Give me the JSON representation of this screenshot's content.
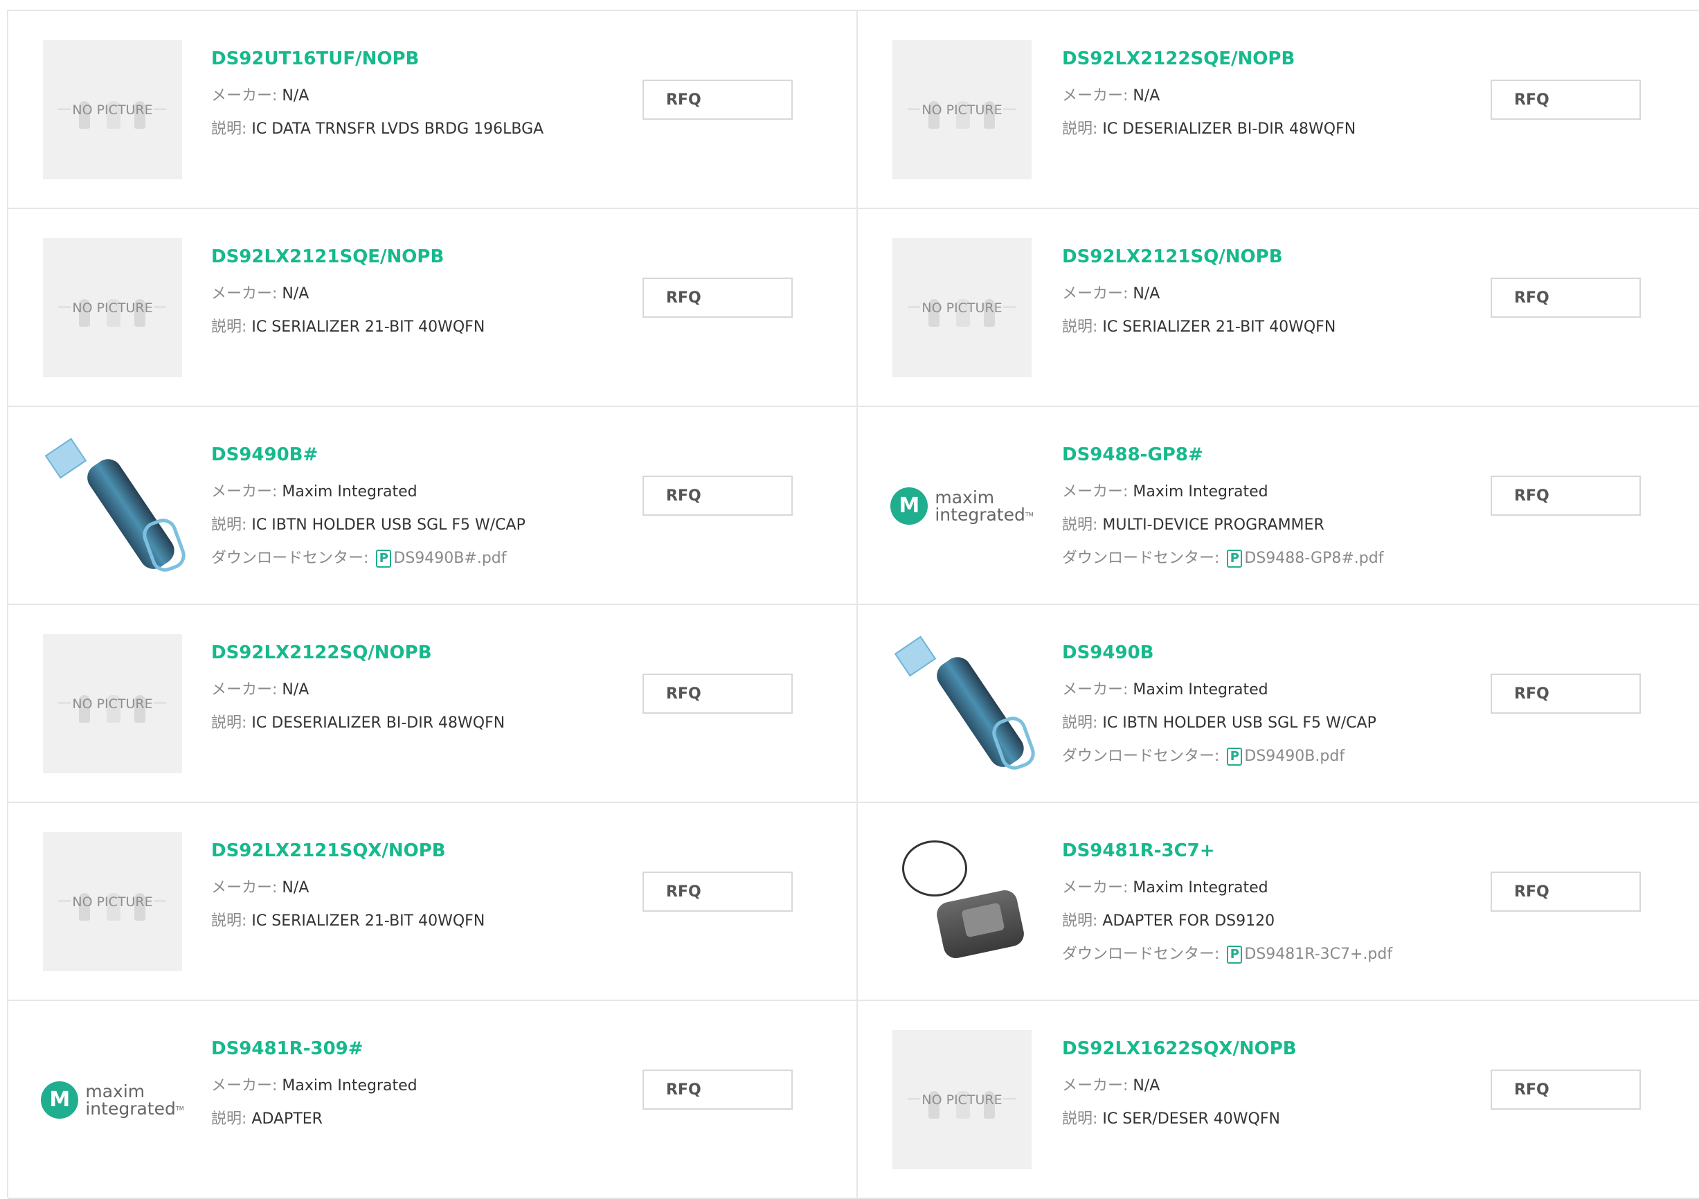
{
  "labels": {
    "maker": "メーカー: ",
    "desc": "説明: ",
    "download": "ダウンロードセンター: ",
    "rfq": "RFQ",
    "no_picture": "NO PICTURE",
    "maxim_line1": "maxim",
    "maxim_line2": "integrated",
    "maxim_tm": "TM"
  },
  "colors": {
    "accent": "#16b98c",
    "border": "#e6e6e6"
  },
  "products": [
    {
      "part": "DS92UT16TUF/NOPB",
      "maker": "N/A",
      "desc": "IC DATA TRNSFR LVDS BRDG 196LBGA",
      "image": "no-picture"
    },
    {
      "part": "DS92LX2122SQE/NOPB",
      "maker": "N/A",
      "desc": "IC DESERIALIZER BI-DIR 48WQFN",
      "image": "no-picture"
    },
    {
      "part": "DS92LX2121SQE/NOPB",
      "maker": "N/A",
      "desc": "IC SERIALIZER 21-BIT 40WQFN",
      "image": "no-picture"
    },
    {
      "part": "DS92LX2121SQ/NOPB",
      "maker": "N/A",
      "desc": "IC SERIALIZER 21-BIT 40WQFN",
      "image": "no-picture"
    },
    {
      "part": "DS9490B#",
      "maker": "Maxim Integrated",
      "desc": "IC IBTN HOLDER USB SGL F5 W/CAP",
      "image": "usb-holder",
      "pdf": "DS9490B#.pdf"
    },
    {
      "part": "DS9488-GP8#",
      "maker": "Maxim Integrated",
      "desc": "MULTI-DEVICE PROGRAMMER",
      "image": "maxim-logo",
      "pdf": "DS9488-GP8#.pdf"
    },
    {
      "part": "DS92LX2122SQ/NOPB",
      "maker": "N/A",
      "desc": "IC DESERIALIZER BI-DIR 48WQFN",
      "image": "no-picture"
    },
    {
      "part": "DS9490B",
      "maker": "Maxim Integrated",
      "desc": "IC IBTN HOLDER USB SGL F5 W/CAP",
      "image": "usb-holder",
      "pdf": "DS9490B.pdf"
    },
    {
      "part": "DS92LX2121SQX/NOPB",
      "maker": "N/A",
      "desc": "IC SERIALIZER 21-BIT 40WQFN",
      "image": "no-picture"
    },
    {
      "part": "DS9481R-3C7+",
      "maker": "Maxim Integrated",
      "desc": "ADAPTER FOR DS9120",
      "image": "adapter",
      "pdf": "DS9481R-3C7+.pdf"
    },
    {
      "part": "DS9481R-309#",
      "maker": "Maxim Integrated",
      "desc": "ADAPTER",
      "image": "maxim-logo"
    },
    {
      "part": "DS92LX1622SQX/NOPB",
      "maker": "N/A",
      "desc": "IC SER/DESER 40WQFN",
      "image": "no-picture"
    }
  ]
}
